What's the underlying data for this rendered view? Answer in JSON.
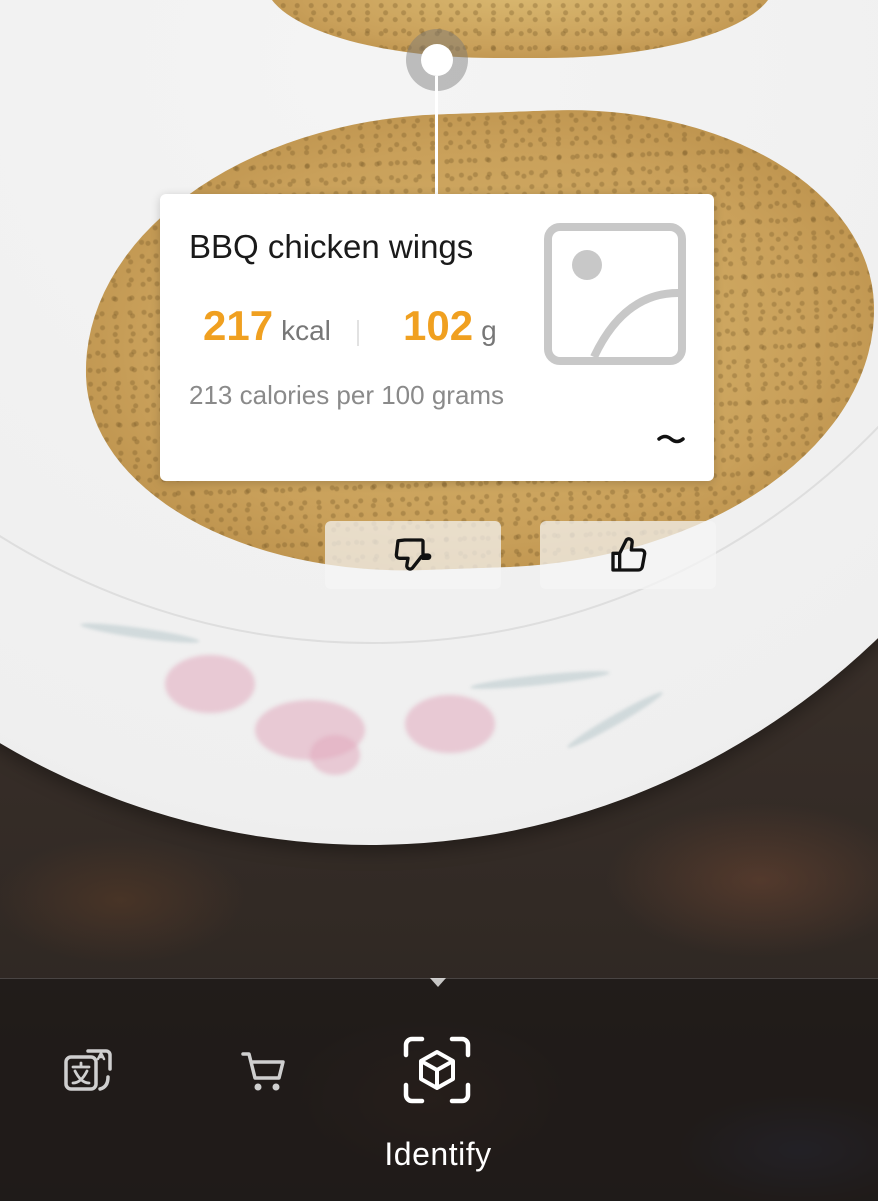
{
  "food_card": {
    "name": "BBQ chicken wings",
    "calories_value": "217",
    "calories_unit": "kcal",
    "weight_value": "102",
    "weight_unit": "g",
    "description": "213 calories per 100 grams",
    "image_placeholder_icon": "image-placeholder-icon",
    "expand_icon": "chevron-icon"
  },
  "feedback": {
    "dislike_icon": "thumbs-down-icon",
    "like_icon": "thumbs-up-icon"
  },
  "toolbar": {
    "modes": [
      {
        "icon": "translate-icon",
        "active": false
      },
      {
        "icon": "shopping-cart-icon",
        "active": false
      },
      {
        "icon": "identify-object-icon",
        "active": true
      }
    ],
    "active_label": "Identify"
  },
  "colors": {
    "accent": "#f0a020",
    "card_background": "#ffffff",
    "title_text": "#1a1a1a",
    "secondary_text": "#8a8a8a"
  }
}
